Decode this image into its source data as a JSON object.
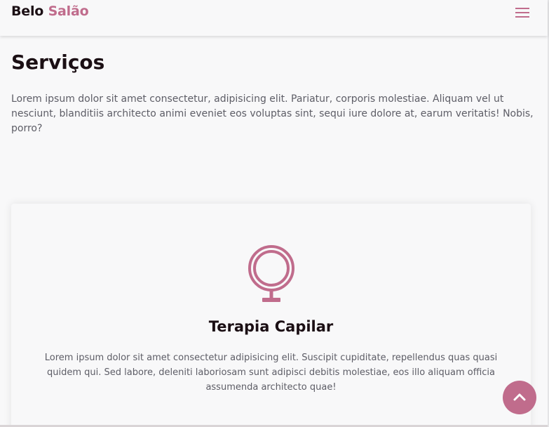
{
  "navbar": {
    "brand_primary": "Belo",
    "brand_accent": "Salão",
    "menu_icon": "hamburger-menu-icon"
  },
  "services": {
    "title": "Serviços",
    "intro": "Lorem ipsum dolor sit amet consectetur, adipisicing elit. Pariatur, corporis molestiae. Aliquam vel ut nesciunt, blanditiis architecto animi eveniet eos voluptas sint, sequi iure dolore at, earum veritatis! Nobis, porro?"
  },
  "service_card": {
    "icon": "hand-mirror-icon",
    "title": "Terapia Capilar",
    "description": "Lorem ipsum dolor sit amet consectetur adipisicing elit. Suscipit cupiditate, repellendus quas quasi quidem qui. Sed labore, deleniti laboriosam sunt adipisci debitis molestiae, eos illo aliquam officia assumenda architecto quae!"
  },
  "back_to_top": {
    "icon": "chevron-up-icon"
  },
  "colors": {
    "accent": "#c06c8c",
    "heading": "#1b0f14",
    "body_text": "#5d5d66",
    "background": "#f8f8f9"
  }
}
